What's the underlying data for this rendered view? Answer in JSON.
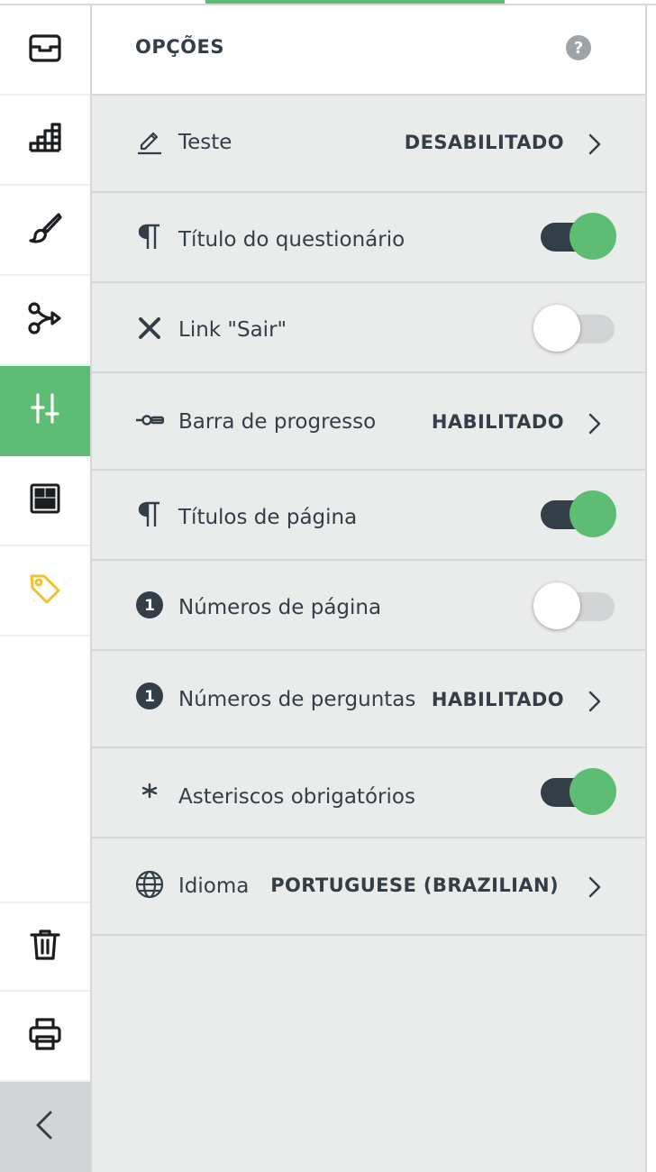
{
  "colors": {
    "accent": "#5ebd74",
    "text": "#333e48",
    "panel_bg": "#eaebeb",
    "tag_icon": "#f2c12e"
  },
  "rail": {
    "items": [
      {
        "icon": "inbox-icon"
      },
      {
        "icon": "bar-chart-icon"
      },
      {
        "icon": "paintbrush-icon"
      },
      {
        "icon": "logic-branch-icon"
      },
      {
        "icon": "options-sliders-icon",
        "active": true
      },
      {
        "icon": "layout-icon"
      },
      {
        "icon": "tag-icon"
      }
    ],
    "bottom": [
      {
        "icon": "trash-icon"
      },
      {
        "icon": "print-icon"
      },
      {
        "icon": "collapse-chevron-icon"
      }
    ]
  },
  "panel": {
    "title": "OPÇÕES",
    "help_glyph": "?",
    "rows": [
      {
        "icon": "pencil-icon",
        "label": "Teste",
        "value": "DESABILITADO",
        "type": "link"
      },
      {
        "icon": "paragraph-icon",
        "label": "Título do questionário",
        "toggle": true,
        "type": "toggle"
      },
      {
        "icon": "x-icon",
        "label": "Link \"Sair\"",
        "toggle": false,
        "type": "toggle"
      },
      {
        "icon": "progress-bar-icon",
        "label": "Barra de progresso",
        "value": "HABILITADO",
        "type": "link"
      },
      {
        "icon": "paragraph-icon",
        "label": "Títulos de página",
        "toggle": true,
        "type": "toggle"
      },
      {
        "icon": "number-one-icon",
        "label": "Números de página",
        "toggle": false,
        "type": "toggle"
      },
      {
        "icon": "number-one-icon",
        "label": "Números de perguntas",
        "value": "HABILITADO",
        "type": "link"
      },
      {
        "icon": "asterisk-icon",
        "label": "Asteriscos obrigatórios",
        "toggle": true,
        "type": "toggle"
      },
      {
        "icon": "globe-icon",
        "label": "Idioma",
        "value": "PORTUGUESE (BRAZILIAN)",
        "type": "link"
      }
    ]
  }
}
